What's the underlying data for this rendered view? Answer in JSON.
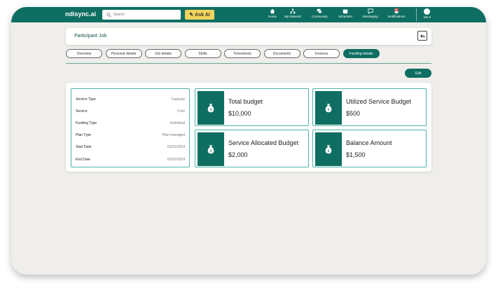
{
  "header": {
    "logo": "ndisync.ai",
    "search_placeholder": "Search",
    "ask_ai_label": "Ask AI",
    "nav": [
      {
        "label": "Home",
        "icon": "home-icon"
      },
      {
        "label": "My Network",
        "icon": "network-icon"
      },
      {
        "label": "Community",
        "icon": "community-icon"
      },
      {
        "label": "Scheduler",
        "icon": "scheduler-icon"
      },
      {
        "label": "Messaging",
        "icon": "messaging-icon"
      },
      {
        "label": "Notifications",
        "icon": "bell-icon",
        "badge": "30"
      }
    ],
    "me_label": "Me"
  },
  "page": {
    "title": "Participant Job",
    "edit_label": "Edit"
  },
  "tabs": [
    "Overview",
    "Personal details",
    "Job details",
    "Shifts",
    "Timesheets",
    "Documents",
    "Invoices",
    "Funding details"
  ],
  "active_tab": "Funding details",
  "details": [
    {
      "label": "Service Type",
      "value": "Capacity"
    },
    {
      "label": "Service",
      "value": "Core"
    },
    {
      "label": "Funding Type",
      "value": "Individual"
    },
    {
      "label": "Plan Type",
      "value": "Plan managed"
    },
    {
      "label": "Start Date",
      "value": "01/01/2024"
    },
    {
      "label": "End Date",
      "value": "01/01/2024"
    }
  ],
  "budgets": [
    {
      "title": "Total budget",
      "value": "$10,000"
    },
    {
      "title": "Utilized Service Budget",
      "value": "$500"
    },
    {
      "title": "Service Allocated Budget",
      "value": "$2,000"
    },
    {
      "title": "Balance Amount",
      "value": "$1,500"
    }
  ],
  "colors": {
    "brand": "#0f6e62",
    "accent": "#f1d45c",
    "background": "#efeeea"
  }
}
